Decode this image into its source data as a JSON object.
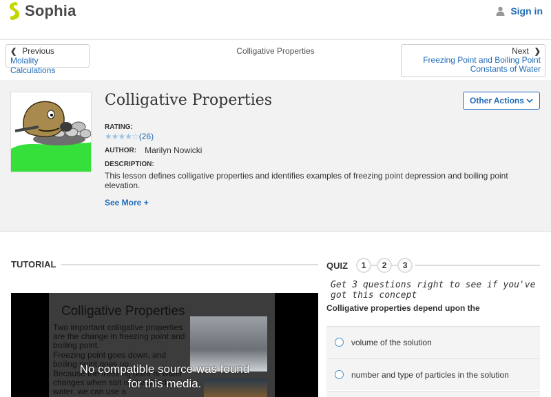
{
  "brand": {
    "name": "Sophia",
    "logo_icon": "sophia-logo-icon",
    "accent": "#1e6bb8"
  },
  "header": {
    "signin_label": "Sign in",
    "signin_icon": "user-icon"
  },
  "nav": {
    "prev_label": "Previous",
    "prev_link": "Molality Calculations",
    "current_title": "Colligative Properties",
    "next_label": "Next",
    "next_link_line1": "Freezing Point and Boiling Point",
    "next_link_line2": "Constants of Water"
  },
  "lesson": {
    "title": "Colligative Properties",
    "other_actions_label": "Other Actions",
    "rating_label": "RATING:",
    "rating_value": 3.5,
    "rating_count": "(26)",
    "author_label": "AUTHOR:",
    "author_name": "Marilyn Nowicki",
    "description_label": "DESCRIPTION:",
    "description": "This lesson defines colligative properties and identifies examples of freezing point depression and boiling point elevation.",
    "see_more_label": "See More +"
  },
  "tutorial": {
    "heading": "TUTORIAL",
    "slide_title": "Colligative Properties",
    "slide_bullets": [
      "Two important colligative properties are the change in freezing point and boiling point.",
      "Freezing point goes down, and boiling point goes up.",
      "Because the freezing point of water changes when salt is dissolved in water, we can use a"
    ],
    "video_message_line1": "No compatible source was found",
    "video_message_line2": "for this media."
  },
  "quiz": {
    "heading": "QUIZ",
    "numbers": [
      "1",
      "2",
      "3"
    ],
    "tagline": "Get 3 questions right to see if you've got this concept",
    "question": "Colligative properties depend upon the",
    "answers": [
      "volume of the solution",
      "number and type of particles in the solution"
    ]
  }
}
